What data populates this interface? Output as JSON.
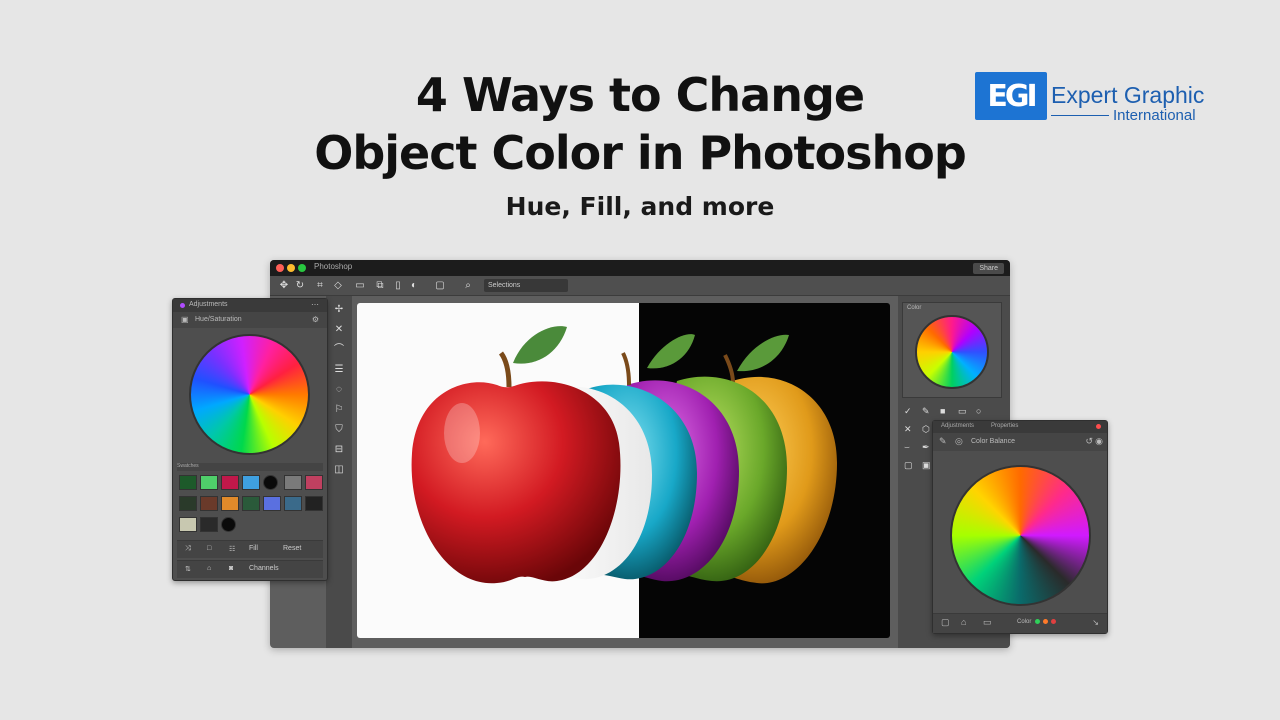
{
  "headline": {
    "line1": "4 Ways to Change",
    "line2": "Object Color in Photoshop",
    "subtitle": "Hue, Fill, and more"
  },
  "logo": {
    "mark": "EGI",
    "name": "Expert Graphic",
    "subname": "International"
  },
  "app_window": {
    "title": "Photoshop",
    "share_label": "Share",
    "options_field": "Selections",
    "toolbar_icons": [
      "move-tool-icon",
      "lasso-tool-icon",
      "crop-icon",
      "shape-icon",
      "rectangle-icon",
      "layers-icon",
      "frame-icon",
      "mobile-icon",
      "contrast-icon"
    ],
    "tools": [
      "move-icon",
      "magic-wand-icon",
      "brush-icon",
      "lasso-icon",
      "gradient-icon",
      "pen-icon",
      "stamp-icon",
      "eyedropper-icon"
    ],
    "canvas": {
      "left_background": "#fbfbfb",
      "right_background": "#050505",
      "apple_colors": [
        "#d21a22",
        "#ffffff",
        "#18a8c8",
        "#a020b0",
        "#6aa82a",
        "#e09a1a"
      ]
    },
    "dock": {
      "panel_label": "Color"
    }
  },
  "left_panel": {
    "title": "Adjustments",
    "sub_label": "Hue/Saturation",
    "section_label": "Swatches",
    "swatch_colors": [
      "#1d5a2a",
      "#4fcf6a",
      "#c0184a",
      "#3fa0e0",
      "#0a0a0a",
      "#7a7a7a",
      "#c04060",
      "#2a3a2a",
      "#6a3a2a",
      "#e08a2a",
      "#2a5a3a",
      "#5a70e0",
      "#3a6a8a",
      "#222222",
      "#c8c8b0",
      "#2a2a2a",
      "#0a0a0a"
    ],
    "row1": {
      "btn1": "Fill",
      "btn2": "Reset"
    },
    "row2": {
      "btn1": "Channels"
    }
  },
  "right_panel": {
    "title": "Adjustments",
    "tab2": "Properties",
    "sub_label": "Color Balance",
    "footer_label": "Color",
    "footer_dots": [
      "#2fd05a",
      "#ff7a2a",
      "#e04040"
    ]
  }
}
